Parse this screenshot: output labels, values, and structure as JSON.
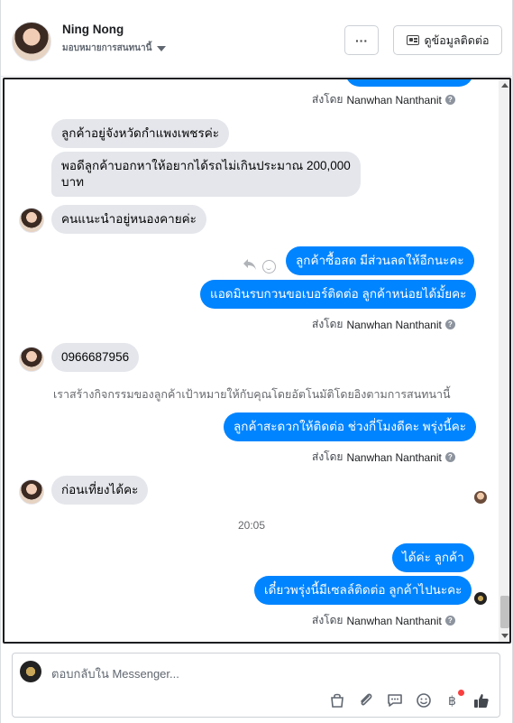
{
  "header": {
    "contact_name": "Ning Nong",
    "contact_status": "มอบหมายการสนทนานี้",
    "contact_info_button": "ดูข้อมูลติดต่อ",
    "more_label": "···"
  },
  "conversation": {
    "sent_by_prefix": "ส่งโดย",
    "sender_name": "Nanwhan Nanthanit",
    "info_mark": "?",
    "messages": {
      "in_1": "ลูกค้าอยู่จังหวัดกำแพงเพชรค่ะ",
      "in_2_line1": "พอดีลูกค้าบอกหาให้อยากได้รถไม่เกินประมาณ 200,000",
      "in_2_line2": "บาท",
      "in_3": "คนแนะนำอยู่หนองคายค่ะ",
      "out_1": "ลูกค้าซื้อสด มีส่วนลดให้อีกนะคะ",
      "out_2": "แอดมินรบกวนขอเบอร์ติดต่อ ลูกค้าหน่อยได้มั้ยคะ",
      "in_4": "0966687956",
      "system_note": "เราสร้างกิจกรรมของลูกค้าเป้าหมายให้กับคุณโดยอัตโนมัติโดยอิงตามการสนทนานี้",
      "out_3": "ลูกค้าสะดวกให้ติดต่อ ช่วงกี่โมงดีคะ พรุ่งนี้คะ",
      "in_5": "ก่อนเที่ยงได้คะ",
      "time_divider": "20:05",
      "out_4": "ได้ค่ะ ลูกค้า",
      "out_5": "เดี๋ยวพรุ่งนี้มีเซลล์ติดต่อ ลูกค้าไปนะคะ"
    }
  },
  "composer": {
    "placeholder": "ตอบกลับใน Messenger..."
  },
  "colors": {
    "outgoing_bubble": "#0084ff",
    "incoming_bubble": "#e4e6eb",
    "notification_dot": "#fa3e3e"
  },
  "icons": [
    "more-icon",
    "contact-card-icon",
    "dropdown-caret-icon",
    "reply-icon",
    "emoji-icon",
    "info-icon",
    "shop-icon",
    "attachment-icon",
    "saved-replies-icon",
    "emoji-icon",
    "payment-icon",
    "like-icon"
  ]
}
